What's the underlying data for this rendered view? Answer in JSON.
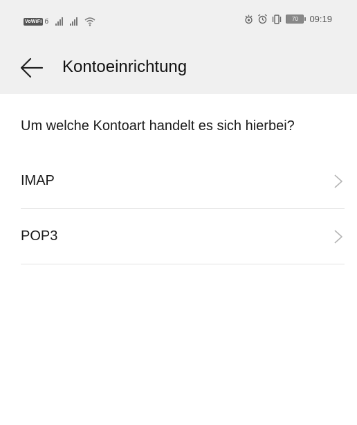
{
  "status_bar": {
    "volte": "VoWiFi",
    "volte_suffix": "б",
    "time": "09:19",
    "battery_level": "70",
    "icons": [
      "signal-icon",
      "signal-icon",
      "wifi-icon",
      "eye-comfort-icon",
      "alarm-icon",
      "vibrate-icon",
      "battery-icon"
    ]
  },
  "header": {
    "back_icon": "arrow-left-icon",
    "title": "Kontoeinrichtung"
  },
  "main": {
    "question": "Um welche Kontoart handelt es sich hierbei?",
    "options": [
      {
        "label": "IMAP",
        "icon": "chevron-right-icon"
      },
      {
        "label": "POP3",
        "icon": "chevron-right-icon"
      }
    ]
  }
}
